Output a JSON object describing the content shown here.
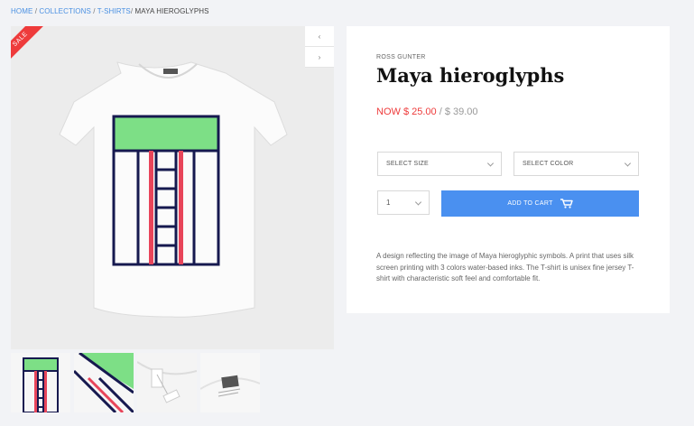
{
  "breadcrumb": {
    "home": "HOME",
    "sep1": " / ",
    "collections": "COLLECTIONS",
    "sep2": " / ",
    "tshirts": "T-SHIRTS",
    "sep3": "/ ",
    "current": "MAYA HIEROGLYPHS"
  },
  "gallery": {
    "sale_badge": "SALE",
    "prev_icon": "chevron-left-icon",
    "next_icon": "chevron-right-icon",
    "thumbnails_count": 4
  },
  "product": {
    "vendor": "ROSS GUNTER",
    "title": "Maya hieroglyphs",
    "price_now": "NOW $ 25.00",
    "price_separator": " / ",
    "price_was": "$ 39.00",
    "size_placeholder": "SELECT SIZE",
    "color_placeholder": "SELECT COLOR",
    "quantity": "1",
    "add_to_cart": "ADD TO CART",
    "cart_icon": "cart-icon",
    "description": "A design reflecting the image of Maya hieroglyphic symbols. A print that uses silk screen printing with 3 colors water-based inks. The T-shirt is unisex fine jersey T-shirt with characteristic soft feel and comfortable fit."
  },
  "colors": {
    "accent_blue": "#4a90f0",
    "sale_red": "#ee3b3b",
    "print_green": "#7ddf86",
    "print_navy": "#16194f",
    "print_red": "#e8455a"
  }
}
